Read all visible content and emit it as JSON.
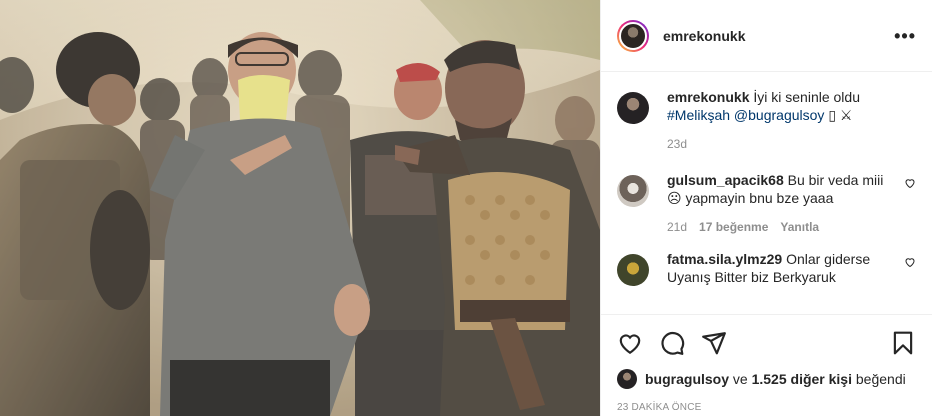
{
  "post": {
    "username": "emrekonukk",
    "more_icon": "more-horizontal-icon"
  },
  "caption": {
    "username": "emrekonukk",
    "text": "İyi ki seninle oldu",
    "hashtag": "#Melikşah",
    "mention": "@bugragulsoy",
    "trailing": "▯ ⚔",
    "time": "23d"
  },
  "comments": [
    {
      "username": "gulsum_apacik68",
      "text": "Bu bir veda miii",
      "text2": "☹ yapmayin bnu bze yaaa",
      "time": "21d",
      "likes": "17 beğenme",
      "reply": "Yanıtla"
    },
    {
      "username": "fatma.sila.ylmz29",
      "text": "Onlar giderse",
      "text2": "Uyanış Bitter biz Berkyaruk"
    }
  ],
  "actions": {
    "like_icon": "heart-icon",
    "comment_icon": "comment-icon",
    "share_icon": "paper-plane-icon",
    "save_icon": "bookmark-icon"
  },
  "likes": {
    "user": "bugragulsoy",
    "connector": "ve",
    "others": "1.525 diğer kişi",
    "suffix": "beğendi"
  },
  "timestamp": "23 DAKİKA ÖNCE"
}
